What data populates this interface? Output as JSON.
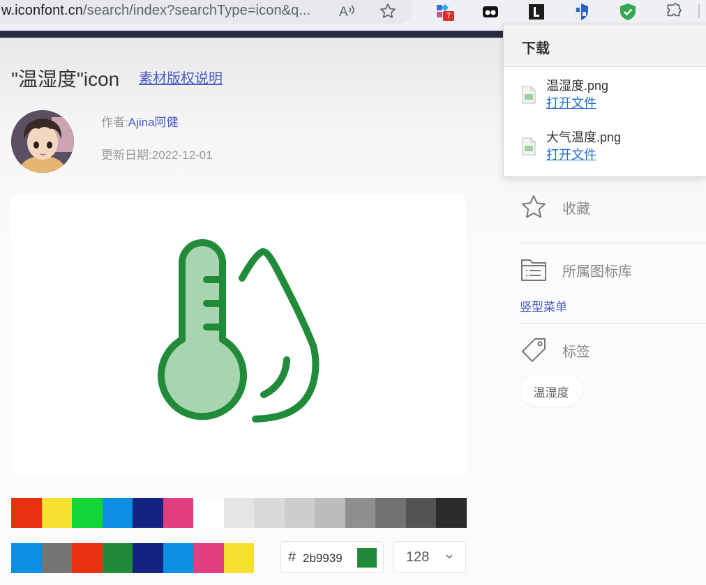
{
  "browser": {
    "url_host": "w.iconfont.cn",
    "url_path": "/search/index?searchType=icon&q...",
    "extension_badge": "7"
  },
  "page": {
    "title": "\"温湿度\"icon",
    "copyright_link": "素材版权说明",
    "author_label": "作者:",
    "author_name": "Ajina阿健",
    "date_label": "更新日期:",
    "date_value": "2022-12-01"
  },
  "icon_preview": {
    "stroke_color": "#228b3a",
    "fill_color": "#a8d4b0"
  },
  "palette": {
    "row1": [
      "#e8300e",
      "#f8e12e",
      "#12d637",
      "#0b8fe2",
      "#14237f",
      "#e33e82",
      "#ffffff",
      "#e5e5e5",
      "#dadada",
      "#cdcdcd",
      "#bcbcbc",
      "#8f8f8f",
      "#727272",
      "#545454",
      "#2b2b2b"
    ],
    "row2": [
      "#0b8fe2",
      "#757575",
      "#e8300e",
      "#228b3a",
      "#14237f",
      "#0b8fe2",
      "#e33e82",
      "#f8e12e"
    ]
  },
  "color_input": {
    "hash": "#",
    "value": "2b9939",
    "swatch": "#228b3a"
  },
  "size_select": {
    "value": "128"
  },
  "sidebar": {
    "favorite_label": "收藏",
    "library_label": "所属图标库",
    "library_link": "竖型菜单",
    "tags_label": "标签",
    "tag": "温湿度"
  },
  "downloads": {
    "title": "下载",
    "items": [
      {
        "name": "温湿度.png",
        "action": "打开文件"
      },
      {
        "name": "大气温度.png",
        "action": "打开文件"
      }
    ]
  }
}
